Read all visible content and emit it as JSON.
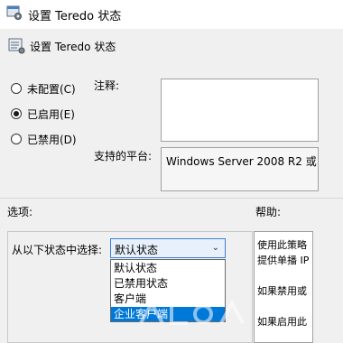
{
  "window": {
    "title": "设置 Teredo 状态"
  },
  "header": {
    "title": "设置 Teredo 状态"
  },
  "state_radios": [
    {
      "label": "未配置(C)",
      "checked": false
    },
    {
      "label": "已启用(E)",
      "checked": true
    },
    {
      "label": "已禁用(D)",
      "checked": false
    }
  ],
  "comment": {
    "label": "注释:",
    "value": ""
  },
  "platform": {
    "label": "支持的平台:",
    "value": "Windows Server 2008 R2 或"
  },
  "sections": {
    "options_label": "选项:",
    "help_label": "帮助:"
  },
  "options": {
    "select_label": "从以下状态中选择:",
    "selected": "默认状态",
    "dropdown_items": [
      "默认状态",
      "已禁用状态",
      "客户端",
      "企业客户端"
    ],
    "highlighted_index": 3
  },
  "help": {
    "lines": [
      "使用此策略",
      "提供单播 IP",
      "",
      "如果禁用或",
      "",
      "如果启用此"
    ]
  }
}
